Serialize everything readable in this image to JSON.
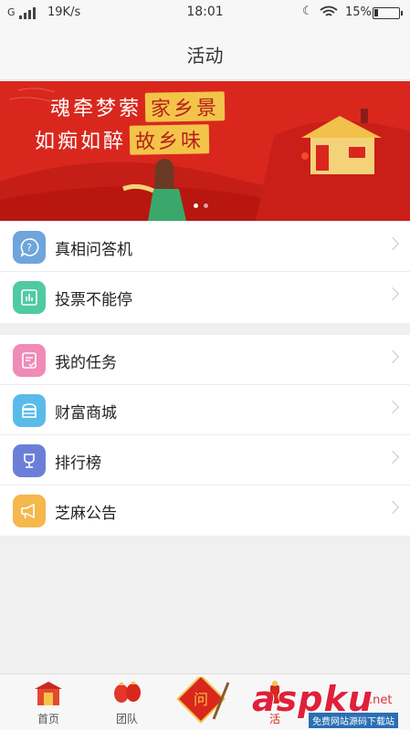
{
  "status": {
    "carrier": "G",
    "speed": "19K/s",
    "time": "18:01",
    "battery": "15%"
  },
  "header": {
    "title": "活动"
  },
  "banner": {
    "line1_prefix": "魂牵梦萦",
    "line1_hl": "家乡景",
    "line2_prefix": "如痴如醉",
    "line2_hl": "故乡味",
    "slides": 2,
    "active_slide": 0,
    "colors": {
      "bg": "#d9271d",
      "highlight": "#f3c44a"
    }
  },
  "group1": [
    {
      "label": "真相问答机",
      "icon": "question-icon",
      "color": "#6ea5dc"
    },
    {
      "label": "投票不能停",
      "icon": "chart-icon",
      "color": "#4fcaa3"
    }
  ],
  "group2": [
    {
      "label": "我的任务",
      "icon": "task-icon",
      "color": "#f08bb8"
    },
    {
      "label": "财富商城",
      "icon": "shop-icon",
      "color": "#5bbbe8"
    },
    {
      "label": "排行榜",
      "icon": "trophy-icon",
      "color": "#6c7fd8"
    },
    {
      "label": "芝麻公告",
      "icon": "megaphone-icon",
      "color": "#f4b84c"
    }
  ],
  "tabbar": {
    "home": "首页",
    "team": "团队",
    "activity": "活",
    "center_icon": "couplet-icon",
    "active_color": "#d9271d"
  },
  "watermark": {
    "brand": "aspku",
    "net": ".net",
    "sub": "免费网站源码下载站"
  }
}
